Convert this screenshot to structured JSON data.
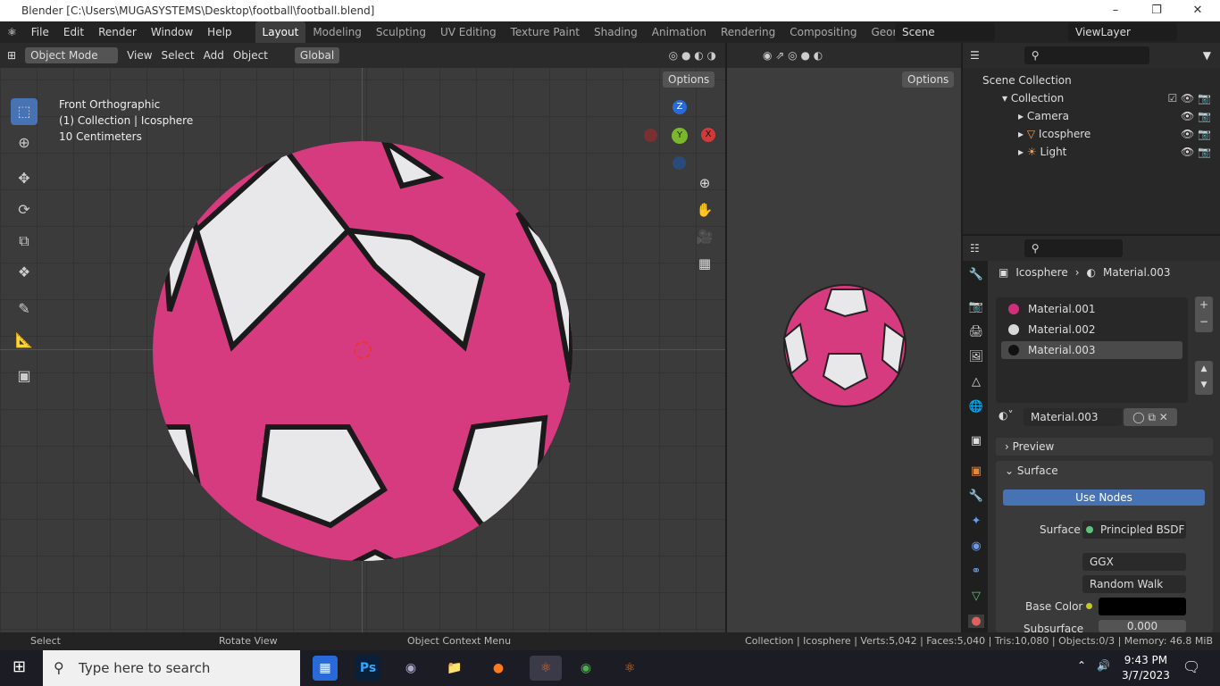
{
  "window": {
    "title": "Blender [C:\\Users\\MUGASYSTEMS\\Desktop\\football\\football.blend]"
  },
  "menu": [
    "File",
    "Edit",
    "Render",
    "Window",
    "Help"
  ],
  "workspaces": [
    "Layout",
    "Modeling",
    "Sculpting",
    "UV Editing",
    "Texture Paint",
    "Shading",
    "Animation",
    "Rendering",
    "Compositing",
    "Geometry Noc"
  ],
  "scene": "Scene",
  "view_layer": "ViewLayer",
  "viewport": {
    "mode": "Object Mode",
    "menus": [
      "View",
      "Select",
      "Add",
      "Object"
    ],
    "orientation": "Global",
    "options": "Options",
    "info": [
      "Front Orthographic",
      "(1) Collection | Icosphere",
      "10 Centimeters"
    ],
    "gizmo": {
      "z": "Z",
      "y": "Y",
      "x": "X"
    }
  },
  "viewport2": {
    "options": "Options"
  },
  "outliner": {
    "root": "Scene Collection",
    "collection": "Collection",
    "items": [
      "Camera",
      "Icosphere",
      "Light"
    ]
  },
  "properties": {
    "object": "Icosphere",
    "material": "Material.003",
    "slots": [
      "Material.001",
      "Material.002",
      "Material.003"
    ],
    "slot_colors": [
      "#d0307a",
      "#d8d8d8",
      "#111111"
    ],
    "material_name": "Material.003",
    "preview": "Preview",
    "surface_panel": "Surface",
    "use_nodes": "Use Nodes",
    "surface_label": "Surface",
    "surface_value": "Principled BSDF",
    "distribution": "GGX",
    "subsurface_method": "Random Walk",
    "base_color_label": "Base Color",
    "base_color": "#000000",
    "subsurface_label": "Subsurface",
    "subsurface_value": "0.000"
  },
  "status": {
    "select": "Select",
    "rotate": "Rotate View",
    "context": "Object Context Menu",
    "stats": "Collection | Icosphere | Verts:5,042 | Faces:5,040 | Tris:10,080 | Objects:0/3 | Memory: 46.8 MiB"
  },
  "taskbar": {
    "search": "Type here to search",
    "time": "9:43 PM",
    "date": "3/7/2023"
  }
}
